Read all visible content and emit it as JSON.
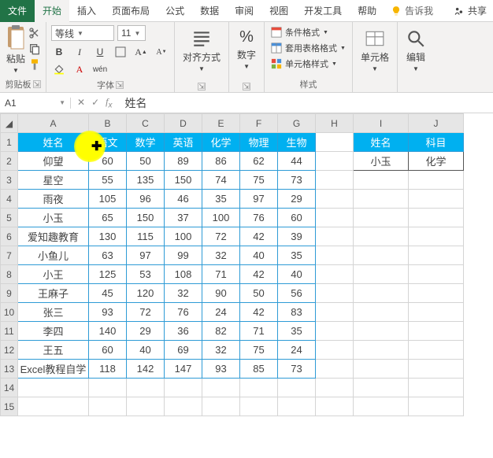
{
  "tabs": {
    "file": "文件",
    "home": "开始",
    "insert": "插入",
    "layout": "页面布局",
    "formulas": "公式",
    "data": "数据",
    "review": "审阅",
    "view": "视图",
    "dev": "开发工具",
    "help": "帮助",
    "tellme": "告诉我",
    "share": "共享"
  },
  "ribbon": {
    "clipboard": {
      "paste": "粘贴",
      "label": "剪贴板"
    },
    "font": {
      "name": "等线",
      "size": "11",
      "wen": "wén",
      "label": "字体"
    },
    "align": {
      "label": "对齐方式"
    },
    "number": {
      "pct": "%",
      "label": "数字"
    },
    "styles": {
      "cond": "条件格式",
      "table": "套用表格格式",
      "cell": "单元格样式",
      "label": "样式"
    },
    "cells": {
      "label": "单元格"
    },
    "editing": {
      "label": "编辑"
    }
  },
  "fx": {
    "cell": "A1",
    "value": "姓名"
  },
  "cols": [
    "A",
    "B",
    "C",
    "D",
    "E",
    "F",
    "G",
    "H",
    "I",
    "J"
  ],
  "headers": [
    "姓名",
    "语文",
    "数学",
    "英语",
    "化学",
    "物理",
    "生物"
  ],
  "rows": [
    [
      "仰望",
      "60",
      "50",
      "89",
      "86",
      "62",
      "44"
    ],
    [
      "星空",
      "55",
      "135",
      "150",
      "74",
      "75",
      "73"
    ],
    [
      "雨夜",
      "105",
      "96",
      "46",
      "35",
      "97",
      "29"
    ],
    [
      "小玉",
      "65",
      "150",
      "37",
      "100",
      "76",
      "60"
    ],
    [
      "爱知趣教育",
      "130",
      "115",
      "100",
      "72",
      "42",
      "39"
    ],
    [
      "小鱼儿",
      "63",
      "97",
      "99",
      "32",
      "40",
      "35"
    ],
    [
      "小王",
      "125",
      "53",
      "108",
      "71",
      "42",
      "40"
    ],
    [
      "王麻子",
      "45",
      "120",
      "32",
      "90",
      "50",
      "56"
    ],
    [
      "张三",
      "93",
      "72",
      "76",
      "24",
      "42",
      "83"
    ],
    [
      "李四",
      "140",
      "29",
      "36",
      "82",
      "71",
      "35"
    ],
    [
      "王五",
      "60",
      "40",
      "69",
      "32",
      "75",
      "24"
    ],
    [
      "Excel教程自学",
      "118",
      "142",
      "147",
      "93",
      "85",
      "73"
    ]
  ],
  "right": {
    "h1": "姓名",
    "h2": "科目",
    "v1": "小玉",
    "v2": "化学"
  }
}
